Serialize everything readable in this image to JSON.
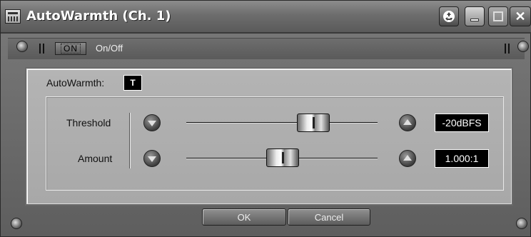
{
  "window": {
    "title": "AutoWarmth (Ch. 1)",
    "icons": [
      "app-icon",
      "recycle-icon",
      "minimize-icon",
      "maximize-icon",
      "close-icon"
    ],
    "close_glyph": "✕"
  },
  "toolbar": {
    "on_label": "ON",
    "onoff_label": "On/Off"
  },
  "autowarmth": {
    "label": "AutoWarmth:",
    "value": "T"
  },
  "controls": [
    {
      "label": "Threshold",
      "value": "-20dBFS",
      "slider_fraction": 0.62
    },
    {
      "label": "Amount",
      "value": "1.000:1",
      "slider_fraction": 0.48
    }
  ],
  "buttons": {
    "ok": "OK",
    "cancel": "Cancel"
  },
  "colors": {
    "frame": "#6a6a6a",
    "panel": "#b0b0b0",
    "value_bg": "#000000",
    "value_fg": "#ffffff"
  }
}
